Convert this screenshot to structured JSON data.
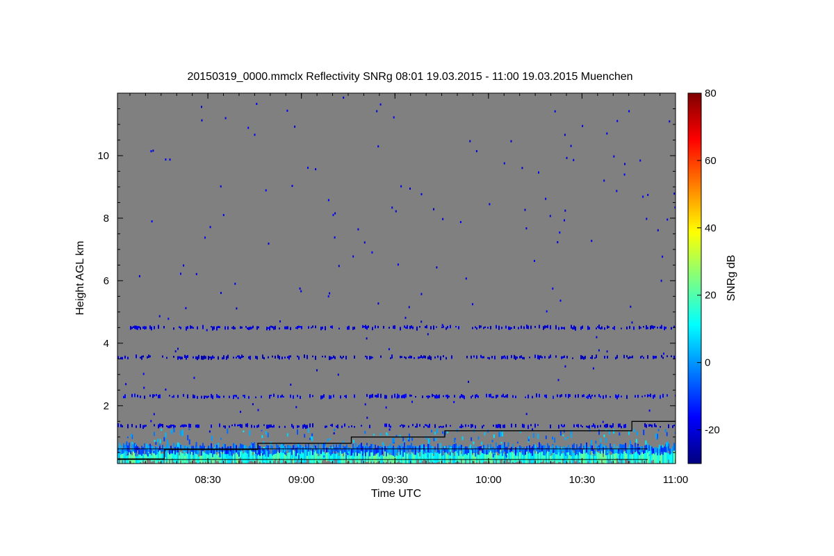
{
  "chart_data": {
    "type": "heatmap",
    "title": "20150319_0000.mmclx Reflectivity SNRg   08:01 19.03.2015 - 11:00 19.03.2015 Muenchen",
    "xlabel": "Time UTC",
    "ylabel": "Height AGL km",
    "xlim": [
      "08:01",
      "11:00"
    ],
    "ylim": [
      0.15,
      12.0
    ],
    "xticks": [
      "08:30",
      "09:00",
      "09:30",
      "10:00",
      "10:30",
      "11:00"
    ],
    "yticks": [
      2,
      4,
      6,
      8,
      10
    ],
    "background_color": "#808080",
    "colorbar": {
      "label": "SNRg dB",
      "range": [
        -30,
        80
      ],
      "ticks": [
        -20,
        0,
        20,
        40,
        60,
        80
      ],
      "colormap": "jet"
    },
    "layers": [
      {
        "height_km": 0.35,
        "snr_db": 15,
        "coverage": "continuous"
      },
      {
        "height_km": 0.6,
        "snr_db": -5,
        "coverage": "continuous"
      },
      {
        "height_km": 1.35,
        "snr_db": -20,
        "coverage": "intermittent"
      },
      {
        "height_km": 2.3,
        "snr_db": -18,
        "coverage": "intermittent"
      },
      {
        "height_km": 3.55,
        "snr_db": -22,
        "coverage": "intermittent"
      },
      {
        "height_km": 4.5,
        "snr_db": -20,
        "coverage": "intermittent"
      }
    ],
    "step_line": {
      "color": "#000000",
      "points": [
        [
          "08:01",
          0.3
        ],
        [
          "08:16",
          0.3
        ],
        [
          "08:16",
          0.6
        ],
        [
          "08:46",
          0.6
        ],
        [
          "08:46",
          0.8
        ],
        [
          "09:16",
          0.8
        ],
        [
          "09:16",
          1.0
        ],
        [
          "09:46",
          1.0
        ],
        [
          "09:46",
          1.2
        ],
        [
          "10:46",
          1.2
        ],
        [
          "10:46",
          1.5
        ],
        [
          "11:00",
          1.5
        ]
      ]
    }
  }
}
